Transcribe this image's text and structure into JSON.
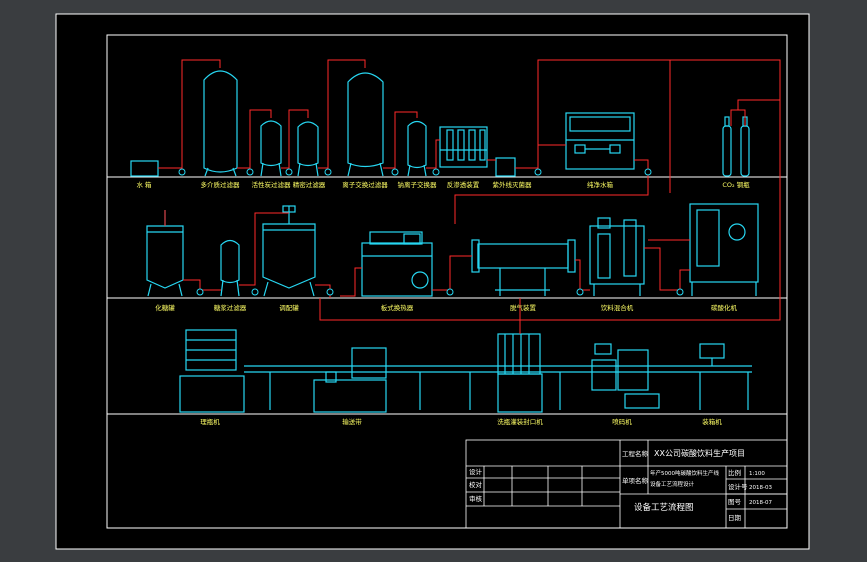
{
  "colors": {
    "background": "#3a3d40",
    "sheet": "#000000",
    "border": "#ffffff",
    "equipment": "#27d7f2",
    "pipe": "#ff2a2a",
    "text": "#ffffff",
    "label": "#ffff66"
  },
  "row1_labels": [
    "水 箱",
    "多介质过滤器",
    "活性炭过滤器",
    "精密过滤器",
    "离子交换过滤器",
    "钠离子交换器",
    "反渗透装置",
    "紫外线灭菌器",
    "纯净水箱",
    "CO₂ 钢瓶"
  ],
  "row2_labels": [
    "化糖罐",
    "糖浆过滤器",
    "调配罐",
    "板式换热器",
    "脱气装置",
    "饮料混合机",
    "碳酸化机"
  ],
  "row3_labels": [
    "理瓶机",
    "输送带",
    "洗瓶灌装封口机",
    "喷码机",
    "装箱机"
  ],
  "title_block": {
    "project_label": "工程名称",
    "project_name": "XX公司碳酸饮料生产项目",
    "unit_label": "单项名称",
    "unit_line1": "年产5000吨碳酸饮料生产线",
    "unit_line2": "设备工艺流程设计",
    "drawing_title": "设备工艺流程图",
    "left_rows": [
      "设计",
      "校对",
      "审核"
    ],
    "right_labels": [
      "比例",
      "设计号",
      "图号",
      "日期"
    ],
    "right_values": [
      "1:100",
      "2018-03",
      "2018-07",
      ""
    ]
  }
}
